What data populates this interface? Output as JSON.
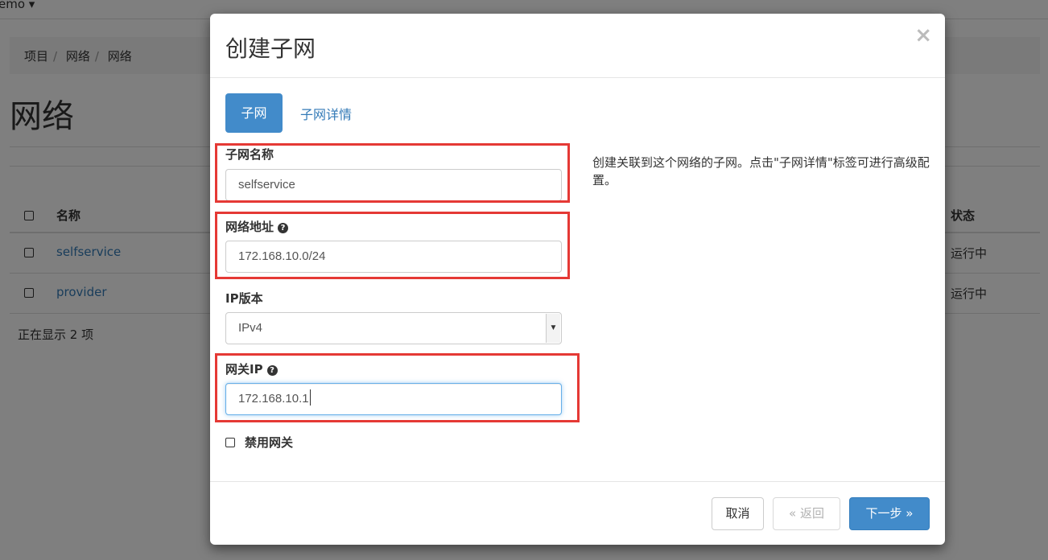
{
  "background": {
    "project_menu": "emo ▾",
    "breadcrumb": [
      "项目",
      "网络",
      "网络"
    ],
    "page_title": "网络",
    "table": {
      "headers": {
        "name": "名称",
        "status": "状态"
      },
      "rows": [
        {
          "name": "selfservice",
          "status": "运行中"
        },
        {
          "name": "provider",
          "status": "运行中"
        }
      ]
    },
    "footer_count": "正在显示 2 项"
  },
  "modal": {
    "title": "创建子网",
    "close_symbol": "×",
    "tabs": [
      {
        "label": "子网",
        "active": true
      },
      {
        "label": "子网详情",
        "active": false
      }
    ],
    "fields": {
      "subnet_name": {
        "label": "子网名称",
        "value": "selfservice"
      },
      "network_address": {
        "label": "网络地址",
        "value": "172.168.10.0/24"
      },
      "ip_version": {
        "label": "IP版本",
        "value": "IPv4"
      },
      "gateway_ip": {
        "label": "网关IP",
        "value": "172.168.10.1"
      },
      "disable_gateway": {
        "label": "禁用网关",
        "checked": false
      }
    },
    "description": "创建关联到这个网络的子网。点击\"子网详情\"标签可进行高级配置。",
    "buttons": {
      "cancel": "取消",
      "back": "« 返回",
      "next": "下一步 »"
    }
  },
  "colors": {
    "primary": "#428bca",
    "link": "#337ab7",
    "highlight": "#e53935"
  },
  "icons": [
    "help-icon",
    "close-icon",
    "chevron-down-icon",
    "checkbox-icon"
  ]
}
